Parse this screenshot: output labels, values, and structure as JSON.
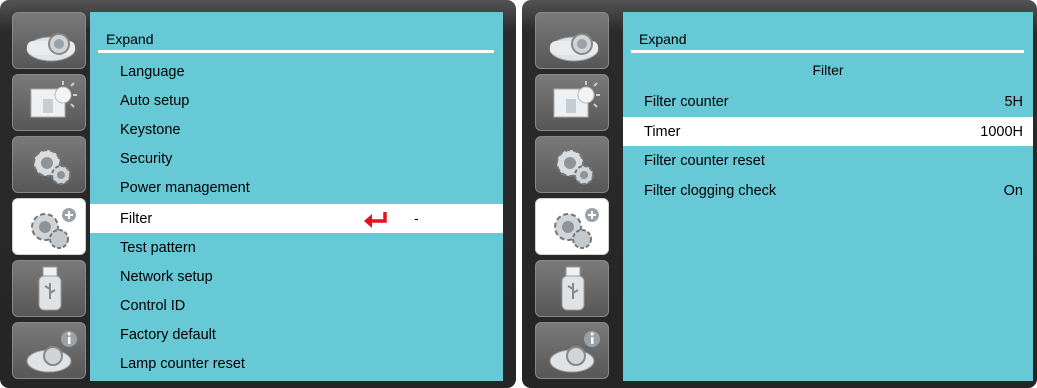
{
  "left_panel": {
    "header": "Expand",
    "menu_items": [
      "Language",
      "Auto setup",
      "Keystone",
      "Security",
      "Power management",
      "Filter",
      "Test pattern",
      "Network setup",
      "Control ID",
      "Factory default",
      "Lamp counter reset"
    ],
    "selected_item": "Filter",
    "selected_value": "-"
  },
  "right_panel": {
    "header": "Expand",
    "subtitle": "Filter",
    "rows": [
      {
        "label": "Filter counter",
        "value": "5H"
      },
      {
        "label": "Timer",
        "value": "1000H"
      },
      {
        "label": "Filter counter reset",
        "value": ""
      },
      {
        "label": "Filter clogging check",
        "value": "On"
      }
    ],
    "selected_row": "Timer"
  },
  "sidebar_icons": [
    "projector-icon",
    "picture-adjust-icon",
    "setting-gear-icon",
    "expand-gear-plus-icon",
    "usb-memory-icon",
    "info-projector-icon"
  ],
  "selected_sidebar_icon": "expand-gear-plus-icon",
  "colors": {
    "menu_bg": "#67c8d6",
    "selected_bg": "#ffffff",
    "enter_arrow": "#e0141a",
    "frame": "#2a2a2a"
  }
}
